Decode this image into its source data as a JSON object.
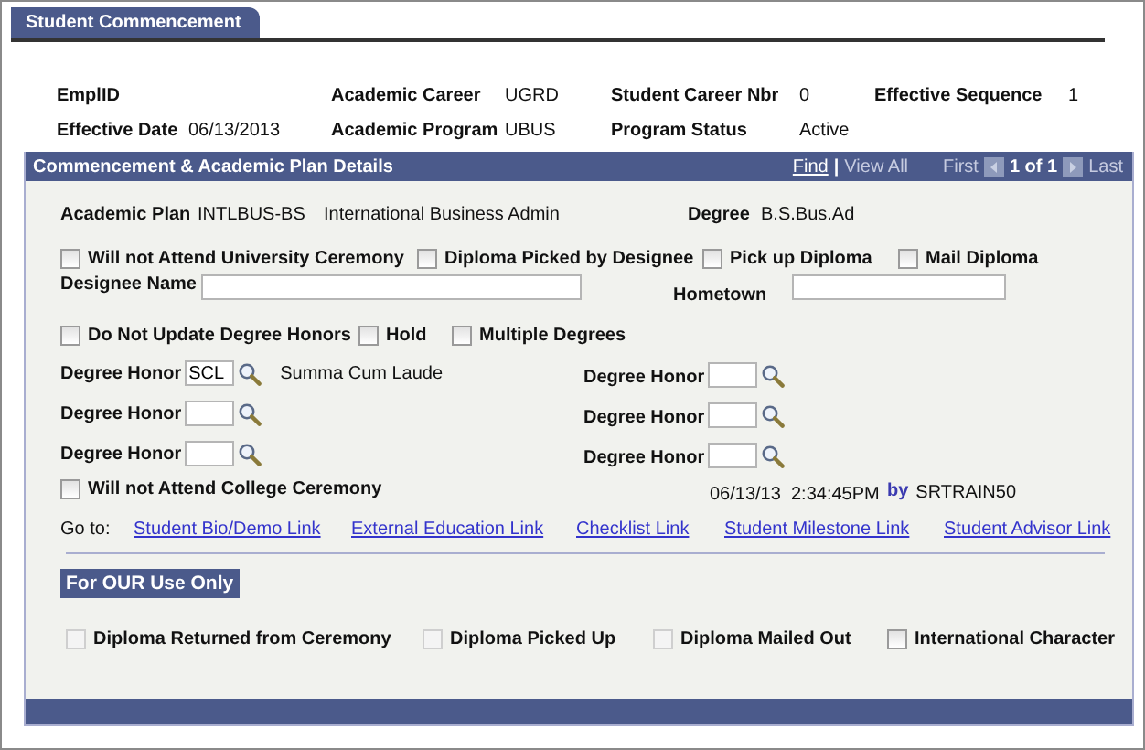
{
  "tab": {
    "label": "Student Commencement",
    "selected": true
  },
  "header": {
    "rows": [
      [
        {
          "label": "EmplID"
        },
        {
          "label": "Academic Career",
          "value": "UGRD"
        },
        {
          "label": "Student Career Nbr",
          "value": "0"
        },
        {
          "label": "Effective Sequence",
          "value": "1"
        }
      ],
      [
        {
          "label": "Effective Date",
          "value": "06/13/2013"
        },
        {
          "label": "Academic Program",
          "value": "UBUS"
        },
        {
          "label": "Program Status",
          "value": "Active"
        }
      ]
    ]
  },
  "panel": {
    "title": "Commencement & Academic Plan Details",
    "nav": {
      "find": "Find",
      "separator": "|",
      "view_all": "View All",
      "first": "First",
      "count": "1 of 1",
      "last": "Last"
    }
  },
  "plan": {
    "label": "Academic Plan",
    "code": "INTLBUS-BS",
    "description": "International Business Admin",
    "degree_label": "Degree",
    "degree": "B.S.Bus.Ad"
  },
  "options_1": [
    {
      "label": "Will not Attend University Ceremony",
      "checked": false
    },
    {
      "label": "Diploma Picked by Designee",
      "checked": false
    },
    {
      "label": "Pick up Diploma",
      "checked": false
    },
    {
      "label": "Mail Diploma",
      "checked": false
    }
  ],
  "designee": {
    "label": "Designee Name"
  },
  "hometown": {
    "label": "Hometown"
  },
  "options_2": [
    {
      "label": "Do Not Update Degree Honors",
      "checked": false
    },
    {
      "label": "Hold",
      "checked": false
    },
    {
      "label": "Multiple Degrees",
      "checked": false
    }
  ],
  "honors": [
    {
      "label": "Degree Honor",
      "code": "SCL",
      "description": "Summa Cum Laude"
    },
    {
      "label": "Degree Honor"
    },
    {
      "label": "Degree Honor"
    },
    {
      "label": "Degree Honor"
    },
    {
      "label": "Degree Honor"
    },
    {
      "label": "Degree Honor"
    }
  ],
  "college_ceremony": {
    "label": "Will not Attend College Ceremony",
    "checked": false
  },
  "stamp": {
    "datetime": "06/13/13  2:34:45PM",
    "by": "by",
    "user": "SRTRAIN50"
  },
  "goto": {
    "label": "Go to:",
    "links": [
      "Student Bio/Demo Link",
      "External Education Link",
      "Checklist Link",
      "Student Milestone Link",
      "Student Advisor Link"
    ]
  },
  "internal": {
    "title": "For OUR Use Only",
    "options": [
      {
        "label": "Diploma Returned from Ceremony",
        "checked": false,
        "disabled": true
      },
      {
        "label": "Diploma Picked Up",
        "checked": false,
        "disabled": true
      },
      {
        "label": "Diploma Mailed Out",
        "checked": false,
        "disabled": true
      },
      {
        "label": "International Character",
        "checked": false,
        "disabled": false
      }
    ]
  }
}
